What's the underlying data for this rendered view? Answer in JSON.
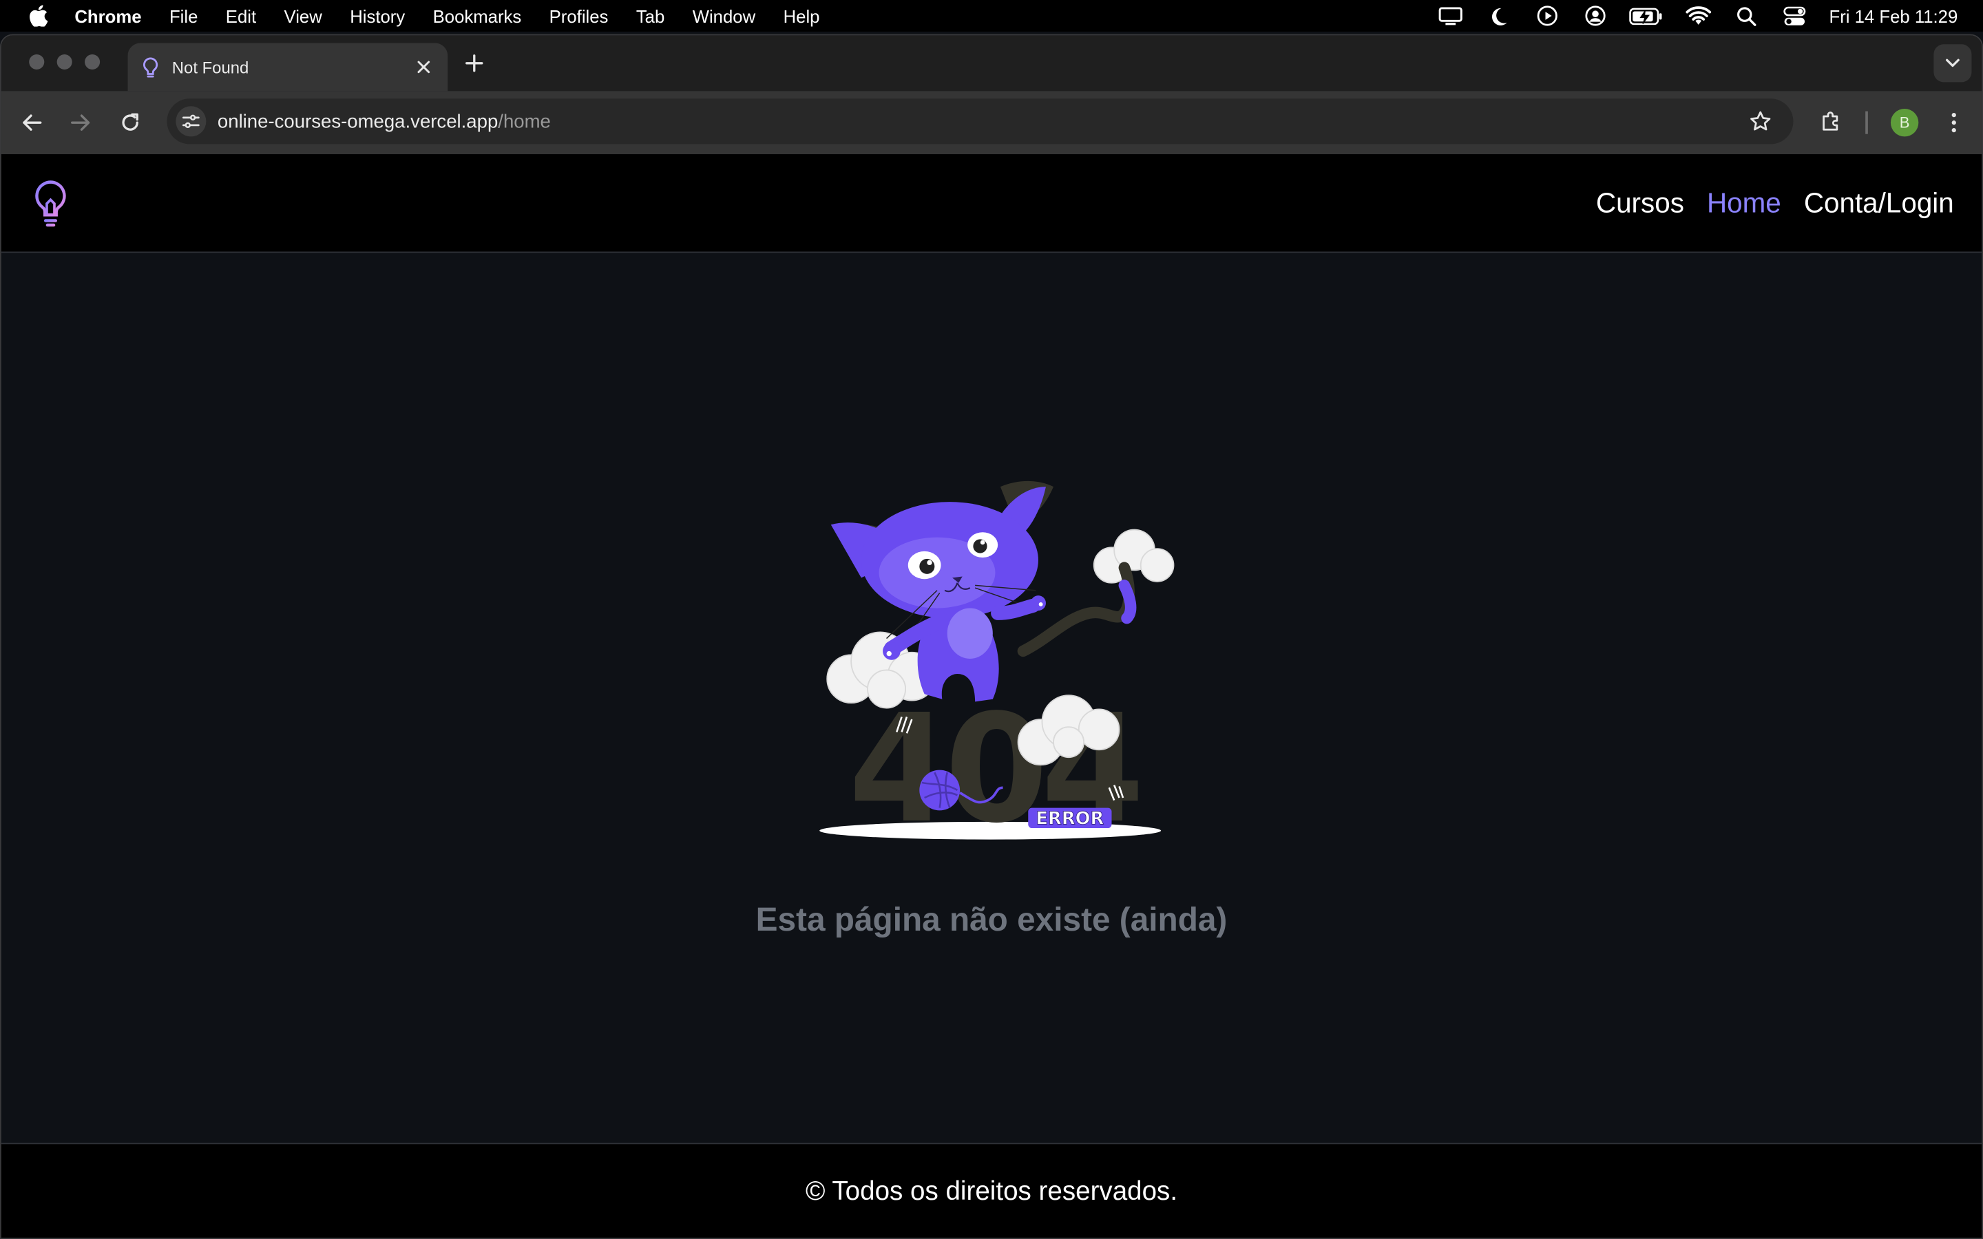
{
  "menubar": {
    "app_name": "Chrome",
    "items": [
      "File",
      "Edit",
      "View",
      "History",
      "Bookmarks",
      "Profiles",
      "Tab",
      "Window",
      "Help"
    ],
    "clock": "Fri 14 Feb  11:29",
    "status_icons": [
      "display-icon",
      "moon-icon",
      "play-circle-icon",
      "user-circle-icon",
      "battery-charging-icon",
      "wifi-icon",
      "search-icon",
      "control-center-icon"
    ]
  },
  "browser": {
    "tab_title": "Not Found",
    "url_host": "online-courses-omega.vercel.app",
    "url_path": "/home",
    "profile_initial": "B"
  },
  "site": {
    "nav": [
      {
        "label": "Cursos",
        "active": false
      },
      {
        "label": "Home",
        "active": true
      },
      {
        "label": "Conta/Login",
        "active": false
      }
    ],
    "illustration_text": {
      "code": "404",
      "badge": "ERROR"
    },
    "message": "Esta página não existe (ainda)",
    "footer": "© Todos os direitos reservados."
  },
  "colors": {
    "accent": "#8b83ff",
    "cat": "#6a4bf0",
    "page_bg": "#0e1116",
    "header_bg": "#000000",
    "message": "#6e747e"
  }
}
